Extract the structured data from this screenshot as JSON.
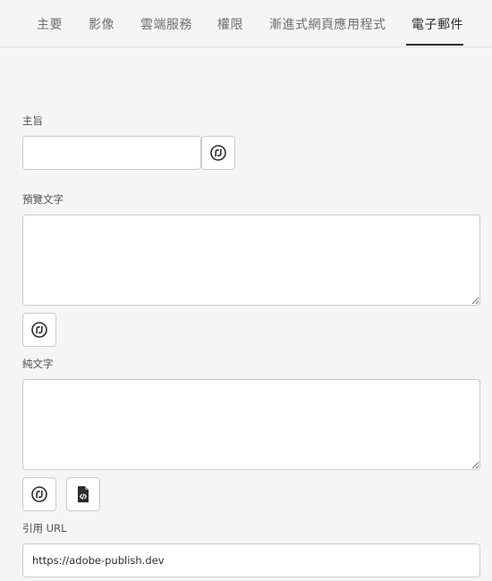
{
  "tabs": [
    {
      "label": "主要",
      "active": false
    },
    {
      "label": "影像",
      "active": false
    },
    {
      "label": "雲端服務",
      "active": false
    },
    {
      "label": "權限",
      "active": false
    },
    {
      "label": "漸進式網頁應用程式",
      "active": false
    },
    {
      "label": "電子郵件",
      "active": true
    }
  ],
  "form": {
    "subject": {
      "label": "主旨",
      "value": "",
      "picker_icon": "variable-picker-icon"
    },
    "preview_text": {
      "label": "預覽文字",
      "value": "",
      "picker_icon": "variable-picker-icon"
    },
    "plain_text": {
      "label": "純文字",
      "value": "",
      "picker_icon": "variable-picker-icon",
      "generate_icon": "code-file-icon"
    },
    "reference_url": {
      "label": "引用 URL",
      "value": "https://adobe-publish.dev"
    }
  },
  "colors": {
    "background": "#f5f5f5",
    "field_background": "#ffffff",
    "border": "#cacaca",
    "active_tab": "#2c2c2c",
    "inactive_tab": "#6e6e6e"
  }
}
